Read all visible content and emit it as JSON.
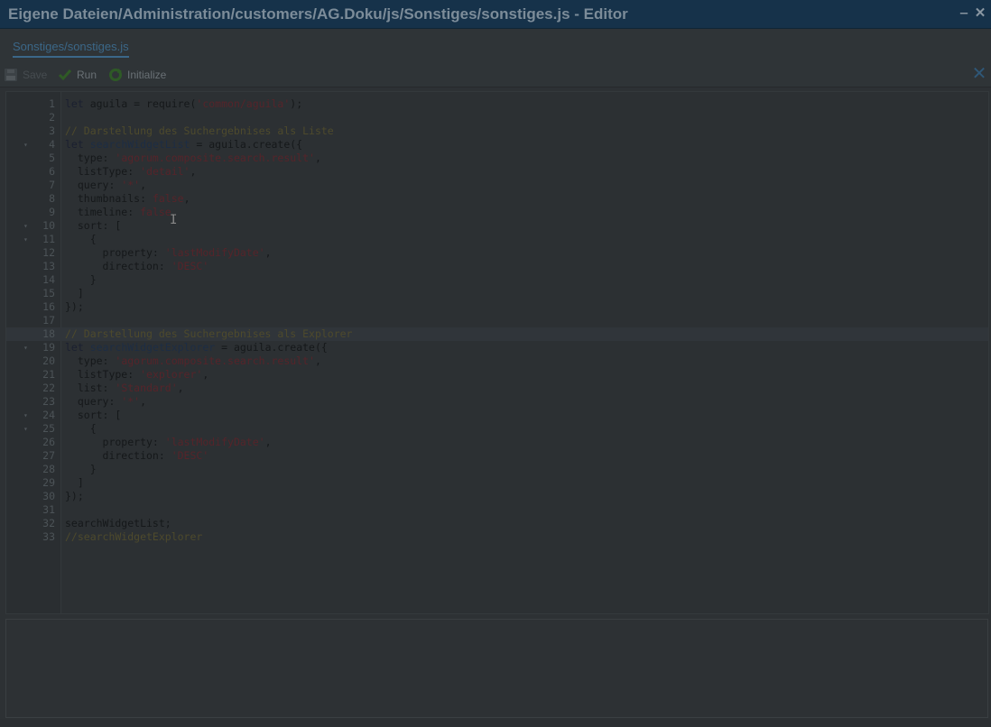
{
  "window": {
    "title": "Eigene Dateien/Administration/customers/AG.Doku/js/Sonstiges/sonstiges.js - Editor",
    "minimize_icon": "minimize-icon",
    "close_icon": "close-icon"
  },
  "tabs": [
    {
      "label": "Sonstiges/sonstiges.js",
      "active": true
    }
  ],
  "toolbar": {
    "save_label": "Save",
    "run_label": "Run",
    "initialize_label": "Initialize",
    "close_label": "✕"
  },
  "editor": {
    "highlighted_line": 18,
    "lines": [
      {
        "n": "1",
        "tokens": [
          [
            "kw",
            "let "
          ],
          [
            "plain",
            "aguila = require("
          ],
          [
            "str",
            "'common/aguila'"
          ],
          [
            "plain",
            ");"
          ]
        ]
      },
      {
        "n": "2",
        "tokens": []
      },
      {
        "n": "3",
        "tokens": [
          [
            "com",
            "// Darstellung des Suchergebnises als Liste"
          ]
        ]
      },
      {
        "n": "4",
        "fold": true,
        "tokens": [
          [
            "kw",
            "let "
          ],
          [
            "var",
            "searchWidgetList"
          ],
          [
            "plain",
            " = aguila.create({"
          ]
        ]
      },
      {
        "n": "5",
        "tokens": [
          [
            "plain",
            "  type: "
          ],
          [
            "str",
            "'agorum.composite.search.result'"
          ],
          [
            "plain",
            ","
          ]
        ]
      },
      {
        "n": "6",
        "tokens": [
          [
            "plain",
            "  listType: "
          ],
          [
            "str",
            "'detail'"
          ],
          [
            "plain",
            ","
          ]
        ]
      },
      {
        "n": "7",
        "tokens": [
          [
            "plain",
            "  query: "
          ],
          [
            "str",
            "'*'"
          ],
          [
            "plain",
            ","
          ]
        ]
      },
      {
        "n": "8",
        "tokens": [
          [
            "plain",
            "  thumbnails: "
          ],
          [
            "str",
            "false"
          ],
          [
            "plain",
            ","
          ]
        ]
      },
      {
        "n": "9",
        "tokens": [
          [
            "plain",
            "  timeline: "
          ],
          [
            "str",
            "false"
          ],
          [
            "plain",
            ","
          ]
        ]
      },
      {
        "n": "10",
        "fold": true,
        "tokens": [
          [
            "plain",
            "  sort: ["
          ]
        ]
      },
      {
        "n": "11",
        "fold": true,
        "tokens": [
          [
            "plain",
            "    {"
          ]
        ]
      },
      {
        "n": "12",
        "tokens": [
          [
            "plain",
            "      property: "
          ],
          [
            "str",
            "'lastModifyDate'"
          ],
          [
            "plain",
            ","
          ]
        ]
      },
      {
        "n": "13",
        "tokens": [
          [
            "plain",
            "      direction: "
          ],
          [
            "str",
            "'DESC'"
          ]
        ]
      },
      {
        "n": "14",
        "tokens": [
          [
            "plain",
            "    }"
          ]
        ]
      },
      {
        "n": "15",
        "tokens": [
          [
            "plain",
            "  ]"
          ]
        ]
      },
      {
        "n": "16",
        "tokens": [
          [
            "plain",
            "});"
          ]
        ]
      },
      {
        "n": "17",
        "tokens": []
      },
      {
        "n": "18",
        "tokens": [
          [
            "com",
            "// Darstellung des Suchergebnises als Explorer"
          ]
        ]
      },
      {
        "n": "19",
        "fold": true,
        "tokens": [
          [
            "kw",
            "let "
          ],
          [
            "var",
            "searchWidgetExplorer"
          ],
          [
            "plain",
            " = aguila.create({"
          ]
        ]
      },
      {
        "n": "20",
        "tokens": [
          [
            "plain",
            "  type: "
          ],
          [
            "str",
            "'agorum.composite.search.result'"
          ],
          [
            "plain",
            ","
          ]
        ]
      },
      {
        "n": "21",
        "tokens": [
          [
            "plain",
            "  listType: "
          ],
          [
            "str",
            "'explorer'"
          ],
          [
            "plain",
            ","
          ]
        ]
      },
      {
        "n": "22",
        "tokens": [
          [
            "plain",
            "  list: "
          ],
          [
            "str",
            "'Standard'"
          ],
          [
            "plain",
            ","
          ]
        ]
      },
      {
        "n": "23",
        "tokens": [
          [
            "plain",
            "  query: "
          ],
          [
            "str",
            "'*'"
          ],
          [
            "plain",
            ","
          ]
        ]
      },
      {
        "n": "24",
        "fold": true,
        "tokens": [
          [
            "plain",
            "  sort: ["
          ]
        ]
      },
      {
        "n": "25",
        "fold": true,
        "tokens": [
          [
            "plain",
            "    {"
          ]
        ]
      },
      {
        "n": "26",
        "tokens": [
          [
            "plain",
            "      property: "
          ],
          [
            "str",
            "'lastModifyDate'"
          ],
          [
            "plain",
            ","
          ]
        ]
      },
      {
        "n": "27",
        "tokens": [
          [
            "plain",
            "      direction: "
          ],
          [
            "str",
            "'DESC'"
          ]
        ]
      },
      {
        "n": "28",
        "tokens": [
          [
            "plain",
            "    }"
          ]
        ]
      },
      {
        "n": "29",
        "tokens": [
          [
            "plain",
            "  ]"
          ]
        ]
      },
      {
        "n": "30",
        "tokens": [
          [
            "plain",
            "});"
          ]
        ]
      },
      {
        "n": "31",
        "tokens": []
      },
      {
        "n": "32",
        "tokens": [
          [
            "plain",
            "searchWidgetList;"
          ]
        ]
      },
      {
        "n": "33",
        "tokens": [
          [
            "com",
            "//searchWidgetExplorer"
          ]
        ]
      }
    ]
  },
  "output": {
    "text": ""
  }
}
